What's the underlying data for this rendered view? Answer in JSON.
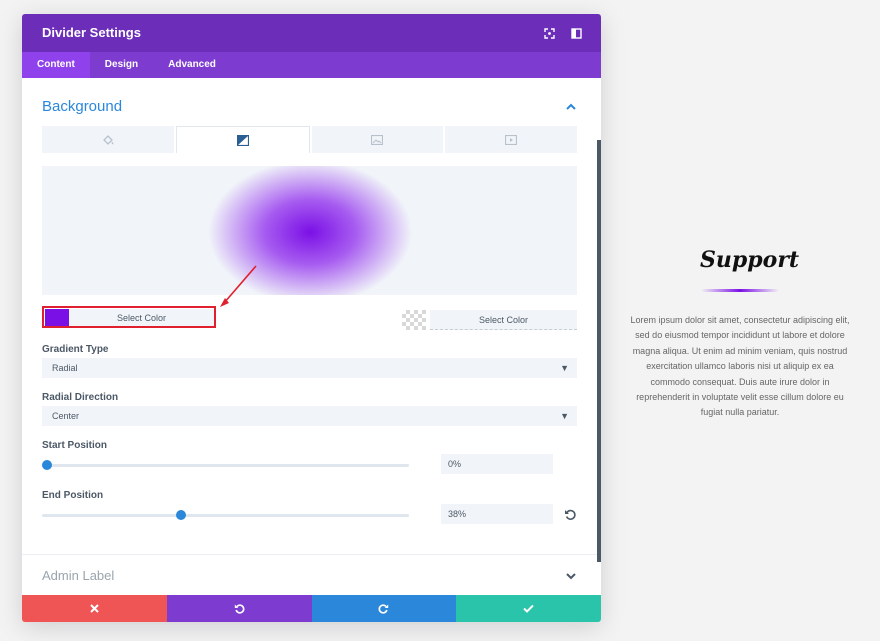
{
  "header": {
    "title": "Divider Settings"
  },
  "tabs": [
    {
      "label": "Content",
      "active": true
    },
    {
      "label": "Design",
      "active": false
    },
    {
      "label": "Advanced",
      "active": false
    }
  ],
  "background": {
    "section_title": "Background",
    "bg_tabs": [
      "paint-bucket-icon",
      "gradient-icon",
      "image-icon",
      "video-icon"
    ],
    "active_bg_tab": 1,
    "gradient_colors": [
      "#7b10e6",
      "transparent"
    ],
    "color1_label": "Select Color",
    "color2_label": "Select Color",
    "gradient_type": {
      "label": "Gradient Type",
      "value": "Radial"
    },
    "radial_direction": {
      "label": "Radial Direction",
      "value": "Center"
    },
    "start_position": {
      "label": "Start Position",
      "value": "0%",
      "fraction": 0.0
    },
    "end_position": {
      "label": "End Position",
      "value": "38%",
      "fraction": 0.38
    }
  },
  "admin": {
    "label": "Admin Label"
  },
  "footer": {
    "buttons": [
      {
        "name": "cancel",
        "icon": "close-icon",
        "color": "#ef5555"
      },
      {
        "name": "undo",
        "icon": "undo-icon",
        "color": "#7e3bd0"
      },
      {
        "name": "redo",
        "icon": "redo-icon",
        "color": "#2b87da"
      },
      {
        "name": "save",
        "icon": "check-icon",
        "color": "#29c4a9"
      }
    ]
  },
  "colors": {
    "header": "#6c2eb9",
    "tabs": "#7e3bd0",
    "accent": "#2b87da",
    "highlight": "#e0202e"
  },
  "support": {
    "title": "Support",
    "text": "Lorem ipsum dolor sit amet, consectetur adipiscing elit, sed do eiusmod tempor incididunt ut labore et dolore magna aliqua. Ut enim ad minim veniam, quis nostrud exercitation ullamco laboris nisi ut aliquip ex ea commodo consequat. Duis aute irure dolor in reprehenderit in voluptate velit esse cillum dolore eu fugiat nulla pariatur."
  }
}
